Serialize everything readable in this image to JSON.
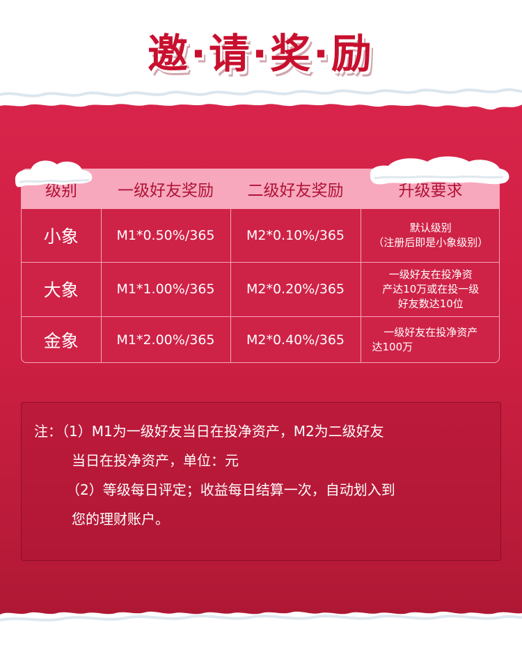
{
  "title": "邀·请·奖·励",
  "table": {
    "headers": [
      "级别",
      "一级好友奖励",
      "二级好友奖励",
      "升级要求"
    ],
    "rows": [
      {
        "level": "小象",
        "first": "M1*0.50%/365",
        "second": "M2*0.10%/365",
        "req": [
          "默认级别",
          "（注册后即是小象级别）"
        ]
      },
      {
        "level": "大象",
        "first": "M1*1.00%/365",
        "second": "M2*0.20%/365",
        "req": [
          "一级好友在投净资",
          "产达10万或在投一级",
          "好友数达10位"
        ]
      },
      {
        "level": "金象",
        "first": "M1*2.00%/365",
        "second": "M2*0.40%/365",
        "req": [
          "一级好友在投净资产",
          "达100万"
        ]
      }
    ]
  },
  "note": {
    "line1": "注：（1）M1为一级好友当日在投净资产，M2为二级好友",
    "line2": "当日在投净资产，单位：元",
    "line3": "（2）等级每日评定；收益每日结算一次，自动划入到",
    "line4": "您的理财账户。"
  }
}
